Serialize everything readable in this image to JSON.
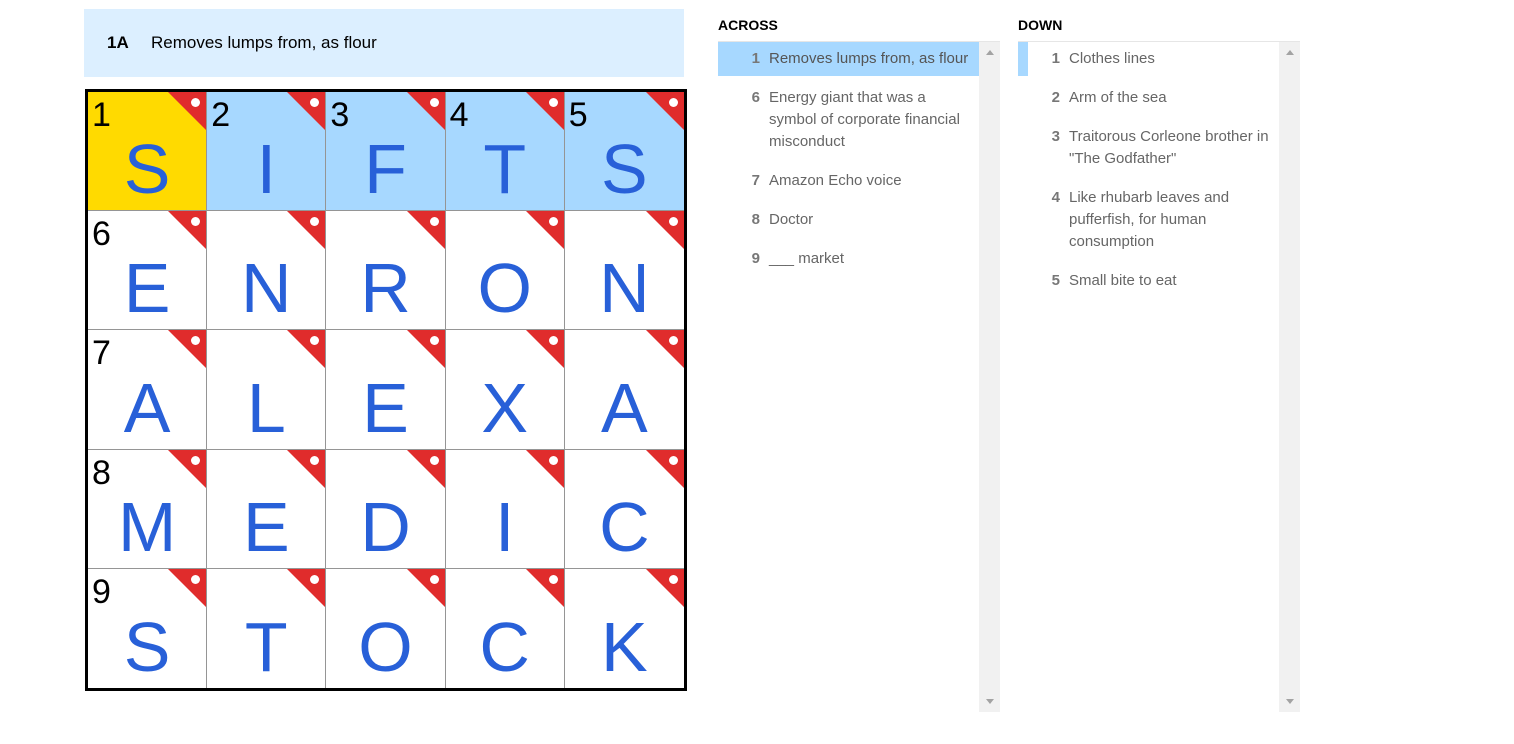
{
  "active_clue": {
    "label": "1A",
    "text": "Removes lumps from, as flour"
  },
  "grid": {
    "rows": [
      [
        {
          "num": "1",
          "letter": "S"
        },
        {
          "num": "2",
          "letter": "I"
        },
        {
          "num": "3",
          "letter": "F"
        },
        {
          "num": "4",
          "letter": "T"
        },
        {
          "num": "5",
          "letter": "S"
        }
      ],
      [
        {
          "num": "6",
          "letter": "E"
        },
        {
          "num": "",
          "letter": "N"
        },
        {
          "num": "",
          "letter": "R"
        },
        {
          "num": "",
          "letter": "O"
        },
        {
          "num": "",
          "letter": "N"
        }
      ],
      [
        {
          "num": "7",
          "letter": "A"
        },
        {
          "num": "",
          "letter": "L"
        },
        {
          "num": "",
          "letter": "E"
        },
        {
          "num": "",
          "letter": "X"
        },
        {
          "num": "",
          "letter": "A"
        }
      ],
      [
        {
          "num": "8",
          "letter": "M"
        },
        {
          "num": "",
          "letter": "E"
        },
        {
          "num": "",
          "letter": "D"
        },
        {
          "num": "",
          "letter": "I"
        },
        {
          "num": "",
          "letter": "C"
        }
      ],
      [
        {
          "num": "9",
          "letter": "S"
        },
        {
          "num": "",
          "letter": "T"
        },
        {
          "num": "",
          "letter": "O"
        },
        {
          "num": "",
          "letter": "C"
        },
        {
          "num": "",
          "letter": "K"
        }
      ]
    ],
    "selected_cell": [
      0,
      0
    ],
    "highlighted_row": 0,
    "revealed_marker": "revealed-corner-icon",
    "colors": {
      "selected": "#ffda00",
      "word": "#a7d8ff",
      "letter": "#2860d8",
      "marker": "#e02c2c"
    }
  },
  "across": {
    "title": "ACROSS",
    "clues": [
      {
        "num": "1",
        "text": "Removes lumps from, as flour",
        "active": true
      },
      {
        "num": "6",
        "text": "Energy giant that was a symbol of corporate financial misconduct"
      },
      {
        "num": "7",
        "text": "Amazon Echo voice"
      },
      {
        "num": "8",
        "text": "Doctor"
      },
      {
        "num": "9",
        "text": "___ market"
      }
    ]
  },
  "down": {
    "title": "DOWN",
    "clues": [
      {
        "num": "1",
        "text": "Clothes lines",
        "cross": true
      },
      {
        "num": "2",
        "text": "Arm of the sea"
      },
      {
        "num": "3",
        "text": "Traitorous Corleone brother in \"The Godfather\""
      },
      {
        "num": "4",
        "text": "Like rhubarb leaves and pufferfish, for human consumption"
      },
      {
        "num": "5",
        "text": "Small bite to eat"
      }
    ]
  }
}
